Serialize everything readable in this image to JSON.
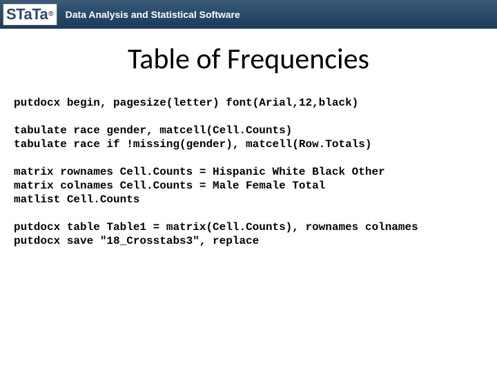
{
  "header": {
    "logo_text": "STaTa",
    "logo_reg": "®",
    "tagline": "Data Analysis and Statistical Software"
  },
  "title": "Table of Frequencies",
  "code": {
    "group1": [
      "putdocx begin, pagesize(letter) font(Arial,12,black)"
    ],
    "group2": [
      "tabulate race gender, matcell(Cell.Counts)",
      "tabulate race if !missing(gender), matcell(Row.Totals)"
    ],
    "group3": [
      "matrix rownames Cell.Counts = Hispanic White Black Other",
      "matrix colnames Cell.Counts = Male Female Total",
      "matlist Cell.Counts"
    ],
    "group4": [
      "putdocx table Table1 = matrix(Cell.Counts), rownames colnames",
      "putdocx save \"18_Crosstabs3\", replace"
    ]
  }
}
